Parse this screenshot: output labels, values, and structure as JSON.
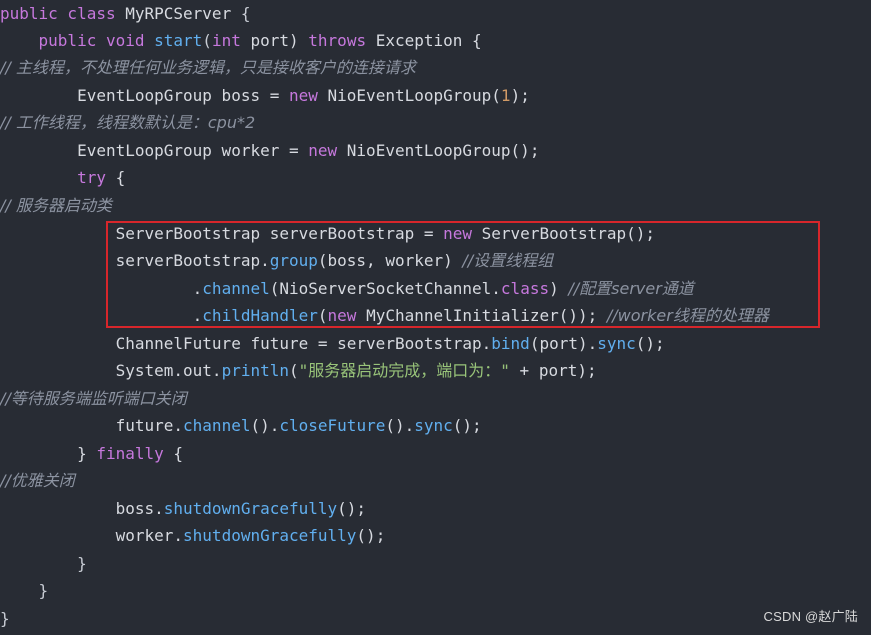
{
  "code": {
    "line1": {
      "t1": "public class ",
      "t2": "MyRPCServer",
      "t3": " {"
    },
    "line2": {
      "t1": "    public void ",
      "t2": "start",
      "t3": "(",
      "t4": "int",
      "t5": " port) ",
      "t6": "throws",
      "t7": " Exception {"
    },
    "line3": "// 主线程，不处理任何业务逻辑，只是接收客户的连接请求",
    "line4": {
      "t1": "        EventLoopGroup boss = ",
      "t2": "new",
      "t3": " NioEventLoopGroup(",
      "t4": "1",
      "t5": ");"
    },
    "line5": "// 工作线程，线程数默认是：cpu*2",
    "line6": {
      "t1": "        EventLoopGroup worker = ",
      "t2": "new",
      "t3": " NioEventLoopGroup();"
    },
    "line7": {
      "t1": "        ",
      "t2": "try",
      "t3": " {"
    },
    "line8": "// 服务器启动类",
    "line9": {
      "t1": "            ServerBootstrap serverBootstrap = ",
      "t2": "new",
      "t3": " ServerBootstrap();"
    },
    "line10": {
      "t1": "            serverBootstrap.",
      "t2": "group",
      "t3": "(boss, worker) ",
      "t4": "//设置线程组"
    },
    "line11": {
      "t1": "                    .",
      "t2": "channel",
      "t3": "(NioServerSocketChannel.",
      "t4": "class",
      "t5": ") ",
      "t6": "//配置server通道"
    },
    "line12": {
      "t1": "                    .",
      "t2": "childHandler",
      "t3": "(",
      "t4": "new",
      "t5": " MyChannelInitializer()); ",
      "t6": "//worker线程的处理器"
    },
    "line13": {
      "t1": "            ChannelFuture future = serverBootstrap.",
      "t2": "bind",
      "t3": "(port).",
      "t4": "sync",
      "t5": "();"
    },
    "line14": {
      "t1": "            System.out.",
      "t2": "println",
      "t3": "(",
      "t4": "\"服务器启动完成，端口为：\"",
      "t5": " + port);"
    },
    "line15": "//等待服务端监听端口关闭",
    "line16": {
      "t1": "            future.",
      "t2": "channel",
      "t3": "().",
      "t4": "closeFuture",
      "t5": "().",
      "t6": "sync",
      "t7": "();"
    },
    "line17": {
      "t1": "        } ",
      "t2": "finally",
      "t3": " {"
    },
    "line18": "//优雅关闭",
    "line19": {
      "t1": "            boss.",
      "t2": "shutdownGracefully",
      "t3": "();"
    },
    "line20": {
      "t1": "            worker.",
      "t2": "shutdownGracefully",
      "t3": "();"
    },
    "line21": "        }",
    "line22": "    }",
    "line23": "}"
  },
  "watermark": "CSDN @赵广陆",
  "colors": {
    "background": "#282c34",
    "keyword": "#c678dd",
    "function": "#61afef",
    "comment": "#8c93a1",
    "string": "#98c379",
    "number": "#d19a66",
    "highlight_border": "#d7262b"
  }
}
